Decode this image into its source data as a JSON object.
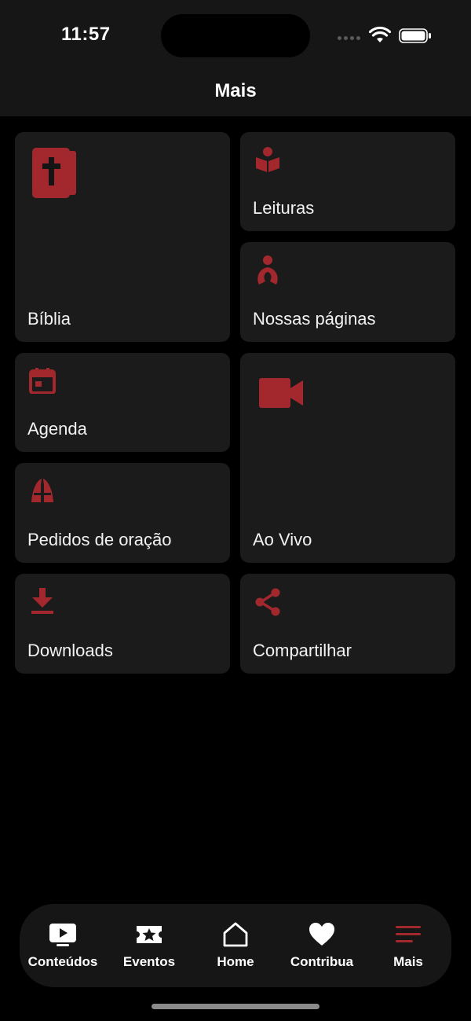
{
  "status_bar": {
    "time": "11:57"
  },
  "header": {
    "title": "Mais"
  },
  "accent_color": "#a3282e",
  "tiles": [
    {
      "label": "Bíblia",
      "icon": "bible-icon"
    },
    {
      "label": "Leituras",
      "icon": "reading-icon"
    },
    {
      "label": "Nossas páginas",
      "icon": "person-ribbon-icon"
    },
    {
      "label": "Agenda",
      "icon": "calendar-icon"
    },
    {
      "label": "Ao Vivo",
      "icon": "video-camera-icon"
    },
    {
      "label": "Pedidos de oração",
      "icon": "praying-hands-icon"
    },
    {
      "label": "Downloads",
      "icon": "download-icon"
    },
    {
      "label": "Compartilhar",
      "icon": "share-icon"
    }
  ],
  "tab_bar": {
    "active": "Mais",
    "items": [
      {
        "label": "Conteúdos",
        "icon": "play-screen-icon"
      },
      {
        "label": "Eventos",
        "icon": "ticket-star-icon"
      },
      {
        "label": "Home",
        "icon": "home-icon"
      },
      {
        "label": "Contribua",
        "icon": "heart-icon"
      },
      {
        "label": "Mais",
        "icon": "menu-icon"
      }
    ]
  }
}
